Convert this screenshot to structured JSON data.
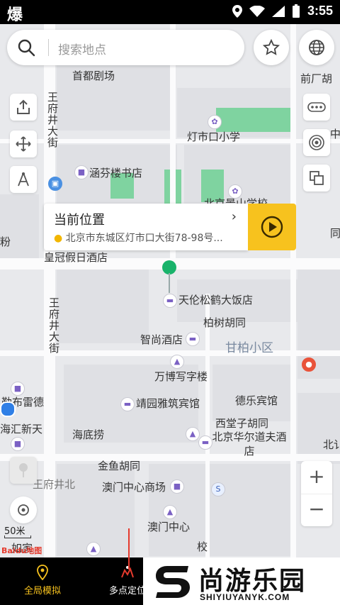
{
  "status_bar": {
    "left_icon": "爆",
    "time": "3:55"
  },
  "search": {
    "placeholder": "搜索地点"
  },
  "popup": {
    "title": "当前位置",
    "address": "北京市东城区灯市口大街78-98号..."
  },
  "scale": {
    "label": "50米"
  },
  "baidu_logo": "Baidu地图",
  "map_labels": {
    "l1": "首都剧场",
    "l2": "前厂胡",
    "l3": "王府井大街",
    "l4": "灯市口小学",
    "l5": "中",
    "l6": "涵芬楼书店",
    "l7": "北京景山学校",
    "l8": "粉",
    "l9": "皇冠假日酒店",
    "l10": "同",
    "l11": "天伦松鹤大饭店",
    "l12": "柏树胡同",
    "l13": "王府井大街",
    "l14": "智尚酒店",
    "l15": "甘柏小区",
    "l16": "万博写字楼",
    "l17": "勒布雷德",
    "l18": "靖园雅筑宾馆",
    "l19": "德乐宾馆",
    "l20": "西堂子胡同",
    "l21": "海汇新天",
    "l22": "海底捞",
    "l23": "北京华尔道夫酒店",
    "l24": "北讠",
    "l25": "金鱼胡同",
    "l26": "王府井北",
    "l27": "澳门中心商场",
    "l28": "澳门中心",
    "l29": "王",
    "l30": "校"
  },
  "tabs": [
    {
      "label": "全局模拟",
      "icon": "location-pin-icon",
      "active": true
    },
    {
      "label": "多点定位",
      "icon": "multi-point-icon",
      "active": false
    }
  ],
  "watermark": {
    "text": "尚游乐园",
    "url": "SHIYIUYANYK.COM"
  },
  "colors": {
    "accent": "#f7c21e",
    "marker": "#19b36b",
    "park": "#7fd3a0",
    "bar": "#000000"
  }
}
